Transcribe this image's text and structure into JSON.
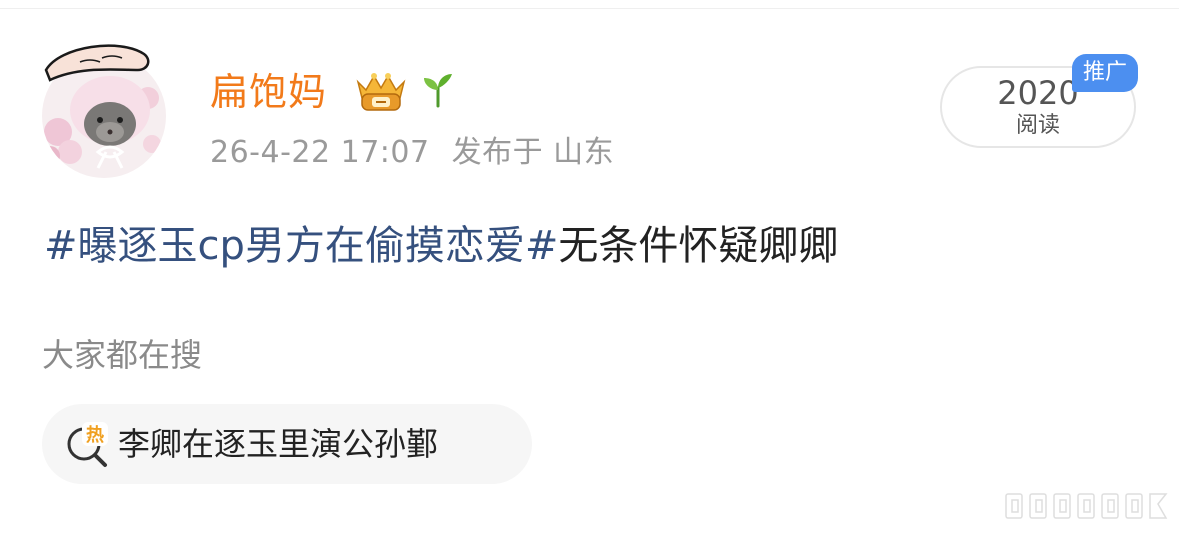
{
  "post": {
    "author": {
      "name": "扁饱妈",
      "avatar_icon": "avatar-hand-patting-hamster",
      "badge_icon": "vip-crown-badge-icon",
      "level_icon": "sprout-icon"
    },
    "timestamp": "26-4-22 17:07",
    "location": "发布于 山东",
    "read_count": "2020",
    "read_label": "阅读",
    "promo_label": "推广",
    "topic": "#曝逐玉cp男方在偷摸恋爱#",
    "body": "无条件怀疑卿卿"
  },
  "search_section": {
    "heading": "大家都在搜",
    "items": [
      {
        "icon": "hot-search-icon",
        "icon_text": "热",
        "label": "李卿在逐玉里演公孙鄞"
      }
    ]
  },
  "colors": {
    "username": "#f27a1a",
    "topic": "#35507e",
    "meta": "#9a9a9a",
    "promo": "#4c8ff0",
    "hot_icon": "#f0a020"
  }
}
